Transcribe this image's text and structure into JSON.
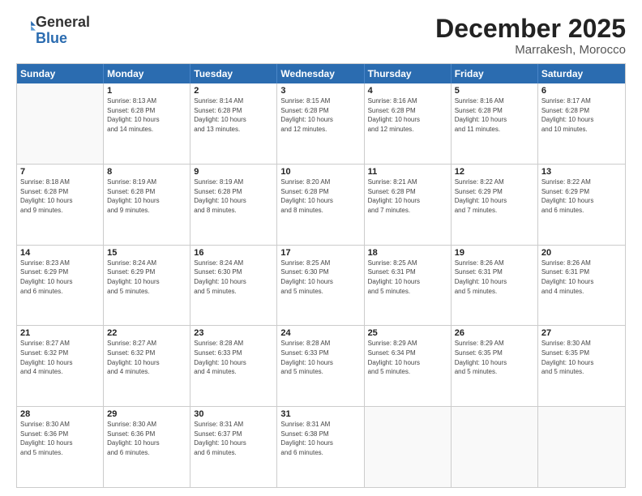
{
  "header": {
    "logo_general": "General",
    "logo_blue": "Blue",
    "month_title": "December 2025",
    "subtitle": "Marrakesh, Morocco"
  },
  "weekdays": [
    "Sunday",
    "Monday",
    "Tuesday",
    "Wednesday",
    "Thursday",
    "Friday",
    "Saturday"
  ],
  "weeks": [
    [
      {
        "day": "",
        "info": ""
      },
      {
        "day": "1",
        "info": "Sunrise: 8:13 AM\nSunset: 6:28 PM\nDaylight: 10 hours\nand 14 minutes."
      },
      {
        "day": "2",
        "info": "Sunrise: 8:14 AM\nSunset: 6:28 PM\nDaylight: 10 hours\nand 13 minutes."
      },
      {
        "day": "3",
        "info": "Sunrise: 8:15 AM\nSunset: 6:28 PM\nDaylight: 10 hours\nand 12 minutes."
      },
      {
        "day": "4",
        "info": "Sunrise: 8:16 AM\nSunset: 6:28 PM\nDaylight: 10 hours\nand 12 minutes."
      },
      {
        "day": "5",
        "info": "Sunrise: 8:16 AM\nSunset: 6:28 PM\nDaylight: 10 hours\nand 11 minutes."
      },
      {
        "day": "6",
        "info": "Sunrise: 8:17 AM\nSunset: 6:28 PM\nDaylight: 10 hours\nand 10 minutes."
      }
    ],
    [
      {
        "day": "7",
        "info": "Sunrise: 8:18 AM\nSunset: 6:28 PM\nDaylight: 10 hours\nand 9 minutes."
      },
      {
        "day": "8",
        "info": "Sunrise: 8:19 AM\nSunset: 6:28 PM\nDaylight: 10 hours\nand 9 minutes."
      },
      {
        "day": "9",
        "info": "Sunrise: 8:19 AM\nSunset: 6:28 PM\nDaylight: 10 hours\nand 8 minutes."
      },
      {
        "day": "10",
        "info": "Sunrise: 8:20 AM\nSunset: 6:28 PM\nDaylight: 10 hours\nand 8 minutes."
      },
      {
        "day": "11",
        "info": "Sunrise: 8:21 AM\nSunset: 6:28 PM\nDaylight: 10 hours\nand 7 minutes."
      },
      {
        "day": "12",
        "info": "Sunrise: 8:22 AM\nSunset: 6:29 PM\nDaylight: 10 hours\nand 7 minutes."
      },
      {
        "day": "13",
        "info": "Sunrise: 8:22 AM\nSunset: 6:29 PM\nDaylight: 10 hours\nand 6 minutes."
      }
    ],
    [
      {
        "day": "14",
        "info": "Sunrise: 8:23 AM\nSunset: 6:29 PM\nDaylight: 10 hours\nand 6 minutes."
      },
      {
        "day": "15",
        "info": "Sunrise: 8:24 AM\nSunset: 6:29 PM\nDaylight: 10 hours\nand 5 minutes."
      },
      {
        "day": "16",
        "info": "Sunrise: 8:24 AM\nSunset: 6:30 PM\nDaylight: 10 hours\nand 5 minutes."
      },
      {
        "day": "17",
        "info": "Sunrise: 8:25 AM\nSunset: 6:30 PM\nDaylight: 10 hours\nand 5 minutes."
      },
      {
        "day": "18",
        "info": "Sunrise: 8:25 AM\nSunset: 6:31 PM\nDaylight: 10 hours\nand 5 minutes."
      },
      {
        "day": "19",
        "info": "Sunrise: 8:26 AM\nSunset: 6:31 PM\nDaylight: 10 hours\nand 5 minutes."
      },
      {
        "day": "20",
        "info": "Sunrise: 8:26 AM\nSunset: 6:31 PM\nDaylight: 10 hours\nand 4 minutes."
      }
    ],
    [
      {
        "day": "21",
        "info": "Sunrise: 8:27 AM\nSunset: 6:32 PM\nDaylight: 10 hours\nand 4 minutes."
      },
      {
        "day": "22",
        "info": "Sunrise: 8:27 AM\nSunset: 6:32 PM\nDaylight: 10 hours\nand 4 minutes."
      },
      {
        "day": "23",
        "info": "Sunrise: 8:28 AM\nSunset: 6:33 PM\nDaylight: 10 hours\nand 4 minutes."
      },
      {
        "day": "24",
        "info": "Sunrise: 8:28 AM\nSunset: 6:33 PM\nDaylight: 10 hours\nand 5 minutes."
      },
      {
        "day": "25",
        "info": "Sunrise: 8:29 AM\nSunset: 6:34 PM\nDaylight: 10 hours\nand 5 minutes."
      },
      {
        "day": "26",
        "info": "Sunrise: 8:29 AM\nSunset: 6:35 PM\nDaylight: 10 hours\nand 5 minutes."
      },
      {
        "day": "27",
        "info": "Sunrise: 8:30 AM\nSunset: 6:35 PM\nDaylight: 10 hours\nand 5 minutes."
      }
    ],
    [
      {
        "day": "28",
        "info": "Sunrise: 8:30 AM\nSunset: 6:36 PM\nDaylight: 10 hours\nand 5 minutes."
      },
      {
        "day": "29",
        "info": "Sunrise: 8:30 AM\nSunset: 6:36 PM\nDaylight: 10 hours\nand 6 minutes."
      },
      {
        "day": "30",
        "info": "Sunrise: 8:31 AM\nSunset: 6:37 PM\nDaylight: 10 hours\nand 6 minutes."
      },
      {
        "day": "31",
        "info": "Sunrise: 8:31 AM\nSunset: 6:38 PM\nDaylight: 10 hours\nand 6 minutes."
      },
      {
        "day": "",
        "info": ""
      },
      {
        "day": "",
        "info": ""
      },
      {
        "day": "",
        "info": ""
      }
    ]
  ]
}
